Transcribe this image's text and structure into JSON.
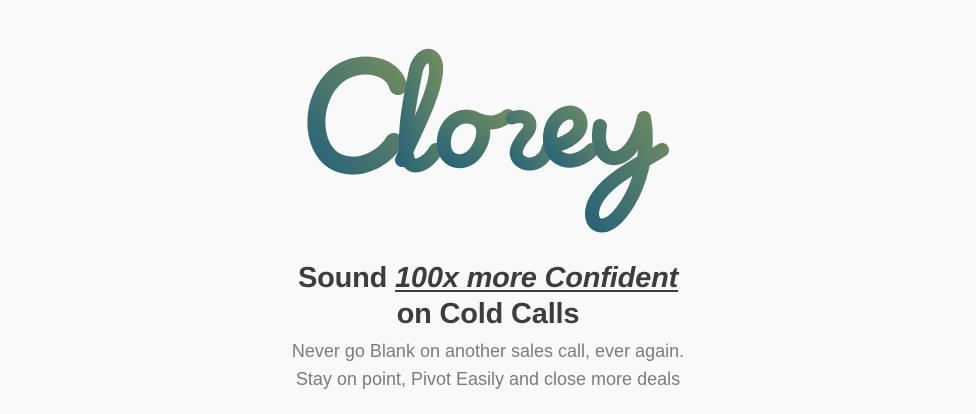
{
  "logo": {
    "text": "Closey",
    "gradient_start": "#2a6478",
    "gradient_end": "#6e8b60"
  },
  "hero": {
    "headline_prefix": "Sound",
    "headline_emphasis": "100x more Confident",
    "headline_line2": "on Cold Calls",
    "subtitle_line1": "Never go Blank on another sales call, ever again.",
    "subtitle_line2": "Stay on point, Pivot Easily and close more deals",
    "headline_color": "#3d3d3d",
    "subtitle_color": "#7c7c7c",
    "background_color": "#f9f9f9"
  }
}
